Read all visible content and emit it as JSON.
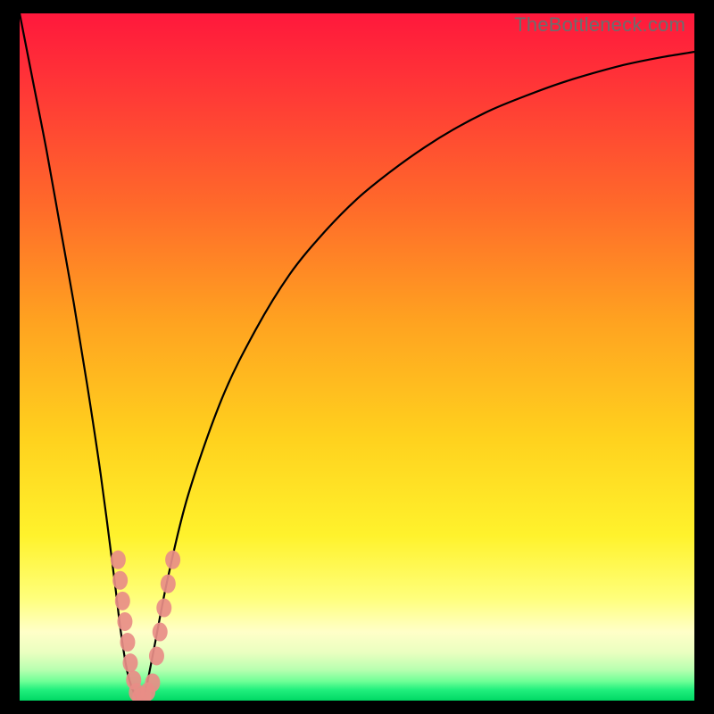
{
  "watermark": "TheBottleneck.com",
  "colors": {
    "black": "#000000",
    "red_top": "#ff1a3a",
    "orange": "#ff8a1f",
    "yellow": "#ffee2a",
    "pale_yellow": "#ffffb0",
    "green": "#00e56a",
    "curve": "#000000",
    "dot_fill": "#e88d87",
    "dot_stroke": "#c77f7a"
  },
  "chart_data": {
    "type": "line",
    "title": "",
    "xlabel": "",
    "ylabel": "",
    "xlim": [
      0,
      100
    ],
    "ylim": [
      0,
      100
    ],
    "series": [
      {
        "name": "bottleneck-curve",
        "x": [
          0,
          2,
          4,
          6,
          8,
          10,
          12,
          14,
          15,
          16,
          17,
          17.8,
          18.5,
          19,
          20,
          22,
          25,
          30,
          35,
          40,
          45,
          50,
          55,
          60,
          65,
          70,
          75,
          80,
          85,
          90,
          95,
          100
        ],
        "y": [
          100,
          90,
          80,
          69,
          58,
          46,
          33,
          18,
          10,
          4,
          1,
          0,
          1,
          3,
          8,
          18,
          30,
          44,
          54,
          62,
          68,
          73,
          77,
          80.5,
          83.5,
          86,
          88,
          89.8,
          91.3,
          92.6,
          93.6,
          94.4
        ]
      }
    ],
    "points": [
      {
        "name": "left-cluster",
        "coords": [
          {
            "x": 14.6,
            "y": 20.5
          },
          {
            "x": 14.9,
            "y": 17.5
          },
          {
            "x": 15.25,
            "y": 14.5
          },
          {
            "x": 15.6,
            "y": 11.5
          },
          {
            "x": 16.0,
            "y": 8.5
          },
          {
            "x": 16.4,
            "y": 5.5
          },
          {
            "x": 16.9,
            "y": 3.0
          }
        ]
      },
      {
        "name": "bottom-cluster",
        "coords": [
          {
            "x": 17.3,
            "y": 1.2
          },
          {
            "x": 17.8,
            "y": 0.5
          },
          {
            "x": 18.4,
            "y": 0.6
          },
          {
            "x": 19.0,
            "y": 1.3
          },
          {
            "x": 19.7,
            "y": 2.6
          }
        ]
      },
      {
        "name": "right-cluster",
        "coords": [
          {
            "x": 20.3,
            "y": 6.5
          },
          {
            "x": 20.8,
            "y": 10.0
          },
          {
            "x": 21.4,
            "y": 13.5
          },
          {
            "x": 22.0,
            "y": 17.0
          },
          {
            "x": 22.7,
            "y": 20.5
          }
        ]
      }
    ]
  }
}
